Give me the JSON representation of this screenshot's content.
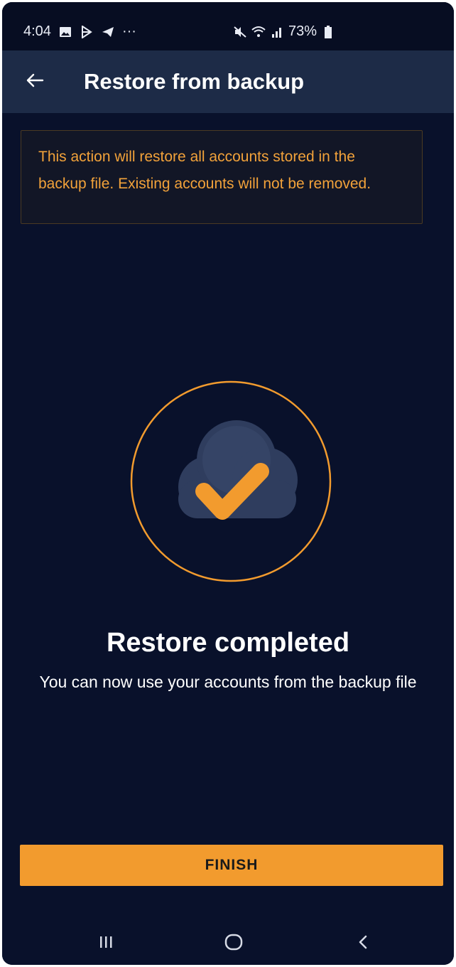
{
  "status_bar": {
    "time": "4:04",
    "more": "···",
    "battery_percent": "73%",
    "icons": [
      "gallery-icon",
      "play-store-icon",
      "telegram-icon",
      "mute-icon",
      "wifi-icon",
      "signal-icon",
      "battery-icon"
    ]
  },
  "app_bar": {
    "title": "Restore from backup",
    "back_icon": "arrow-left-icon"
  },
  "warning": {
    "text": "This action will restore all accounts stored in the backup file. Existing accounts will not be removed."
  },
  "result": {
    "icon": "cloud-check-icon",
    "title": "Restore completed",
    "description": "You can now use your accounts from the backup file"
  },
  "actions": {
    "finish_label": "FINISH"
  },
  "nav_bar": {
    "icons": [
      "recent-apps-icon",
      "home-icon",
      "back-icon"
    ]
  },
  "colors": {
    "background": "#09112b",
    "app_bar": "#1d2b47",
    "accent": "#f29b2e",
    "warning_text": "#f2a23a",
    "cloud": "#3a4a6e"
  }
}
